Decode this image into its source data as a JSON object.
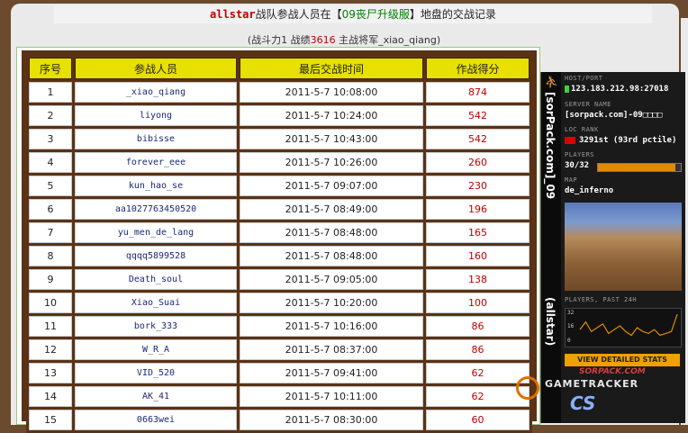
{
  "header": {
    "team": "allstar",
    "text_a": "战队参战人员在【",
    "server": "09丧尸升级服",
    "text_b": "】地盘的交战记录"
  },
  "subtitle": {
    "prefix": "(战斗力1 战绩",
    "score": "3616",
    "suffix": " 主战将军_xiao_qiang)"
  },
  "table": {
    "columns": [
      "序号",
      "参战人员",
      "最后交战时间",
      "作战得分"
    ],
    "rows": [
      {
        "idx": "1",
        "name": "_xiao_qiang",
        "time": "2011-5-7 10:08:00",
        "score": "874"
      },
      {
        "idx": "2",
        "name": "liyong",
        "time": "2011-5-7 10:24:00",
        "score": "542"
      },
      {
        "idx": "3",
        "name": "bibisse",
        "time": "2011-5-7 10:43:00",
        "score": "542"
      },
      {
        "idx": "4",
        "name": "forever_eee",
        "time": "2011-5-7 10:26:00",
        "score": "260"
      },
      {
        "idx": "5",
        "name": "kun_hao_se",
        "time": "2011-5-7 09:07:00",
        "score": "230"
      },
      {
        "idx": "6",
        "name": "aa1027763450520",
        "time": "2011-5-7 08:49:00",
        "score": "196"
      },
      {
        "idx": "7",
        "name": "yu_men_de_lang",
        "time": "2011-5-7 08:48:00",
        "score": "165"
      },
      {
        "idx": "8",
        "name": "qqqq5899528",
        "time": "2011-5-7 08:48:00",
        "score": "160"
      },
      {
        "idx": "9",
        "name": "Death_soul",
        "time": "2011-5-7 09:05:00",
        "score": "138"
      },
      {
        "idx": "10",
        "name": "Xiao_Suai",
        "time": "2011-5-7 10:20:00",
        "score": "100"
      },
      {
        "idx": "11",
        "name": "bork_333",
        "time": "2011-5-7 10:16:00",
        "score": "86"
      },
      {
        "idx": "12",
        "name": "W_R_A",
        "time": "2011-5-7 08:37:00",
        "score": "86"
      },
      {
        "idx": "13",
        "name": "VID_520",
        "time": "2011-5-7 09:41:00",
        "score": "62"
      },
      {
        "idx": "14",
        "name": "AK_41",
        "time": "2011-5-7 10:11:00",
        "score": "62"
      },
      {
        "idx": "15",
        "name": "0663wei",
        "time": "2011-5-7 08:30:00",
        "score": "60"
      }
    ]
  },
  "banner": {
    "vertical_server": "[sorPack.com]_09",
    "vertical_team": "(allstar)",
    "host_label": "HOST/PORT",
    "host_value": "123.183.212.98:27018",
    "server_label": "SERVER NAME",
    "server_value": "[sorpack.com]-09□□□□",
    "loc_label": "LOC  RANK",
    "rank_value": "3291st (93rd pctile)",
    "players_label": "PLAYERS",
    "players_value": "30/32",
    "players_fill": 0.94,
    "map_label": "MAP",
    "map_value": "de_inferno",
    "chart_label": "PLAYERS, PAST 24H",
    "chart_ticks": [
      "32",
      "16",
      "0"
    ],
    "chart_values": [
      14,
      22,
      12,
      16,
      20,
      10,
      14,
      18,
      12,
      8,
      16,
      12,
      10,
      14,
      8,
      10,
      12,
      30
    ],
    "stats_button": "VIEW DETAILED STATS",
    "site_text": "SORPACK.COM",
    "gt_text": "GAMETRACKER",
    "cs_text": "CS"
  },
  "colors": {
    "accent_red": "#c00000",
    "header_yellow": "#e8e000",
    "frame_brown": "#5a3216",
    "server_green": "#008000"
  }
}
